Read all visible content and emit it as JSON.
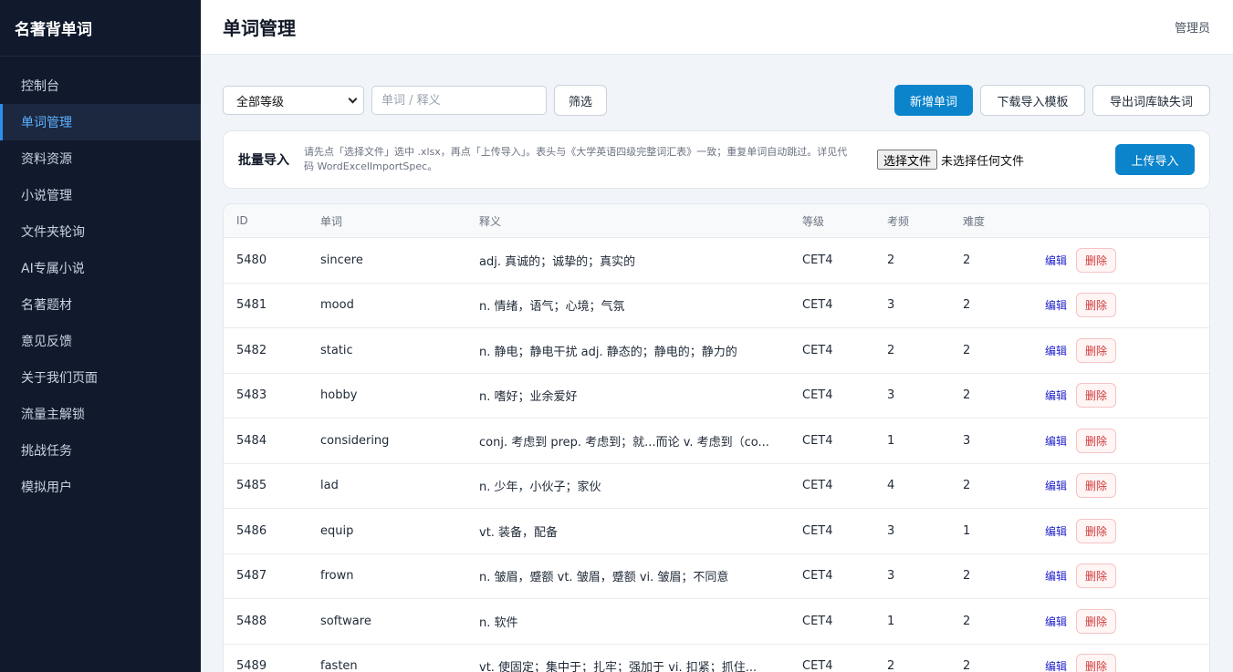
{
  "brand": "名著背单词",
  "sidebar": {
    "items": [
      {
        "label": "控制台"
      },
      {
        "label": "单词管理"
      },
      {
        "label": "资料资源"
      },
      {
        "label": "小说管理"
      },
      {
        "label": "文件夹轮询"
      },
      {
        "label": "AI专属小说"
      },
      {
        "label": "名著题材"
      },
      {
        "label": "意见反馈"
      },
      {
        "label": "关于我们页面"
      },
      {
        "label": "流量主解锁"
      },
      {
        "label": "挑战任务"
      },
      {
        "label": "模拟用户"
      }
    ],
    "active_index": 1
  },
  "header": {
    "title": "单词管理",
    "user": "管理员"
  },
  "filters": {
    "level_select": "全部等级",
    "search_placeholder": "单词 / 释义",
    "filter_label": "筛选",
    "add_label": "新增单词",
    "template_label": "下载导入模板",
    "export_label": "导出词库缺失词"
  },
  "import": {
    "title": "批量导入",
    "desc": "请先点「选择文件」选中 .xlsx，再点「上传导入」。表头与《大学英语四级完整词汇表》一致；重复单词自动跳过。详见代码 WordExcelImportSpec。",
    "choose_label": "选择文件",
    "file_status": "未选择任何文件",
    "upload_label": "上传导入"
  },
  "table": {
    "columns": [
      "ID",
      "单词",
      "释义",
      "等级",
      "考频",
      "难度"
    ],
    "edit_label": "编辑",
    "delete_label": "删除",
    "rows": [
      {
        "id": "5480",
        "word": "sincere",
        "meaning": "adj. 真诚的；诚挚的；真实的",
        "level": "CET4",
        "freq": "2",
        "difficulty": "2"
      },
      {
        "id": "5481",
        "word": "mood",
        "meaning": "n. 情绪，语气；心境；气氛",
        "level": "CET4",
        "freq": "3",
        "difficulty": "2"
      },
      {
        "id": "5482",
        "word": "static",
        "meaning": "n. 静电；静电干扰 adj. 静态的；静电的；静力的",
        "level": "CET4",
        "freq": "2",
        "difficulty": "2"
      },
      {
        "id": "5483",
        "word": "hobby",
        "meaning": "n. 嗜好；业余爱好",
        "level": "CET4",
        "freq": "3",
        "difficulty": "2"
      },
      {
        "id": "5484",
        "word": "considering",
        "meaning": "conj. 考虑到 prep. 考虑到；就...而论 v. 考虑到（co...",
        "level": "CET4",
        "freq": "1",
        "difficulty": "3"
      },
      {
        "id": "5485",
        "word": "lad",
        "meaning": "n. 少年，小伙子；家伙",
        "level": "CET4",
        "freq": "4",
        "difficulty": "2"
      },
      {
        "id": "5486",
        "word": "equip",
        "meaning": "vt. 装备，配备",
        "level": "CET4",
        "freq": "3",
        "difficulty": "1"
      },
      {
        "id": "5487",
        "word": "frown",
        "meaning": "n. 皱眉，蹙额 vt. 皱眉，蹙额 vi. 皱眉；不同意",
        "level": "CET4",
        "freq": "3",
        "difficulty": "2"
      },
      {
        "id": "5488",
        "word": "software",
        "meaning": "n. 软件",
        "level": "CET4",
        "freq": "1",
        "difficulty": "2"
      },
      {
        "id": "5489",
        "word": "fasten",
        "meaning": "vt. 使固定；集中于；扎牢；强加于 vi. 扣紧；抓住...",
        "level": "CET4",
        "freq": "2",
        "difficulty": "2"
      }
    ]
  }
}
